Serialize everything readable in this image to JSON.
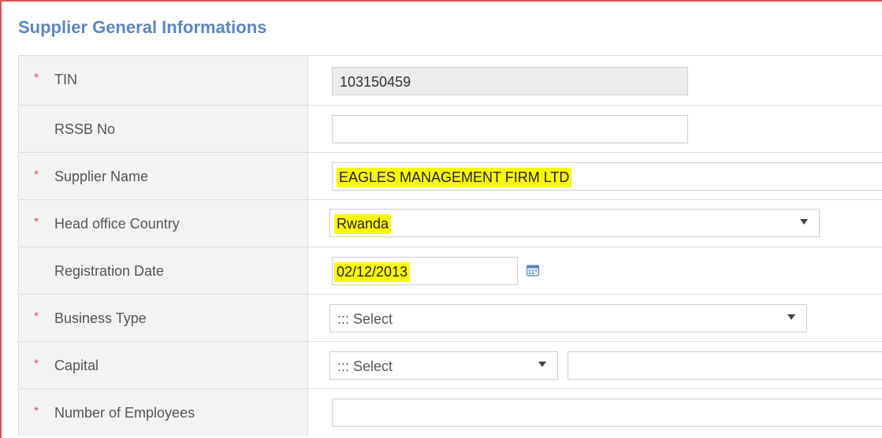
{
  "section": {
    "title": "Supplier General Informations"
  },
  "rows": [
    {
      "label": "TIN",
      "required": "*",
      "value": "103150459"
    },
    {
      "label": "RSSB No",
      "required": "",
      "value": ""
    },
    {
      "label": "Supplier Name",
      "required": "*",
      "value": "EAGLES MANAGEMENT FIRM  LTD"
    },
    {
      "label": "Head office Country",
      "required": "*",
      "value": "Rwanda"
    },
    {
      "label": "Registration Date",
      "required": "",
      "value": "02/12/2013"
    },
    {
      "label": "Business Type",
      "required": "*",
      "value": "::: Select"
    },
    {
      "label": "Capital",
      "required": "*",
      "value": "::: Select",
      "amount": ""
    },
    {
      "label": "Number of Employees",
      "required": "*",
      "value": ""
    }
  ],
  "colors": {
    "title": "#5b86c2",
    "required_marker": "#e05050",
    "highlight": "#fbfb00",
    "label_bg": "#f3f3f3",
    "frame_border": "#d9534f"
  },
  "icons": {
    "registration_date": "calendar-icon",
    "dropdown": "chevron-down-icon"
  }
}
